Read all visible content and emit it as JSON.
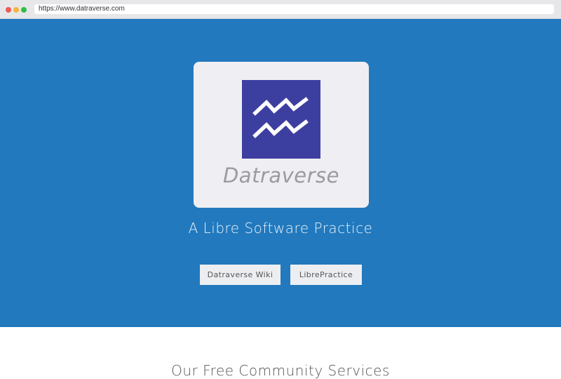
{
  "browser": {
    "url": "https://www.datraverse.com"
  },
  "hero": {
    "logo_alt": "Datraverse",
    "wordmark": "Datraverse",
    "tagline": "A Libre Software Practice",
    "buttons": [
      {
        "label": "Datraverse Wiki"
      },
      {
        "label": "LibrePractice"
      }
    ]
  },
  "section": {
    "title": "Our Free Community Services"
  },
  "colors": {
    "hero_bg": "#2279bd",
    "logo_bg": "#3d3fa0",
    "card_bg": "#efeef2"
  }
}
